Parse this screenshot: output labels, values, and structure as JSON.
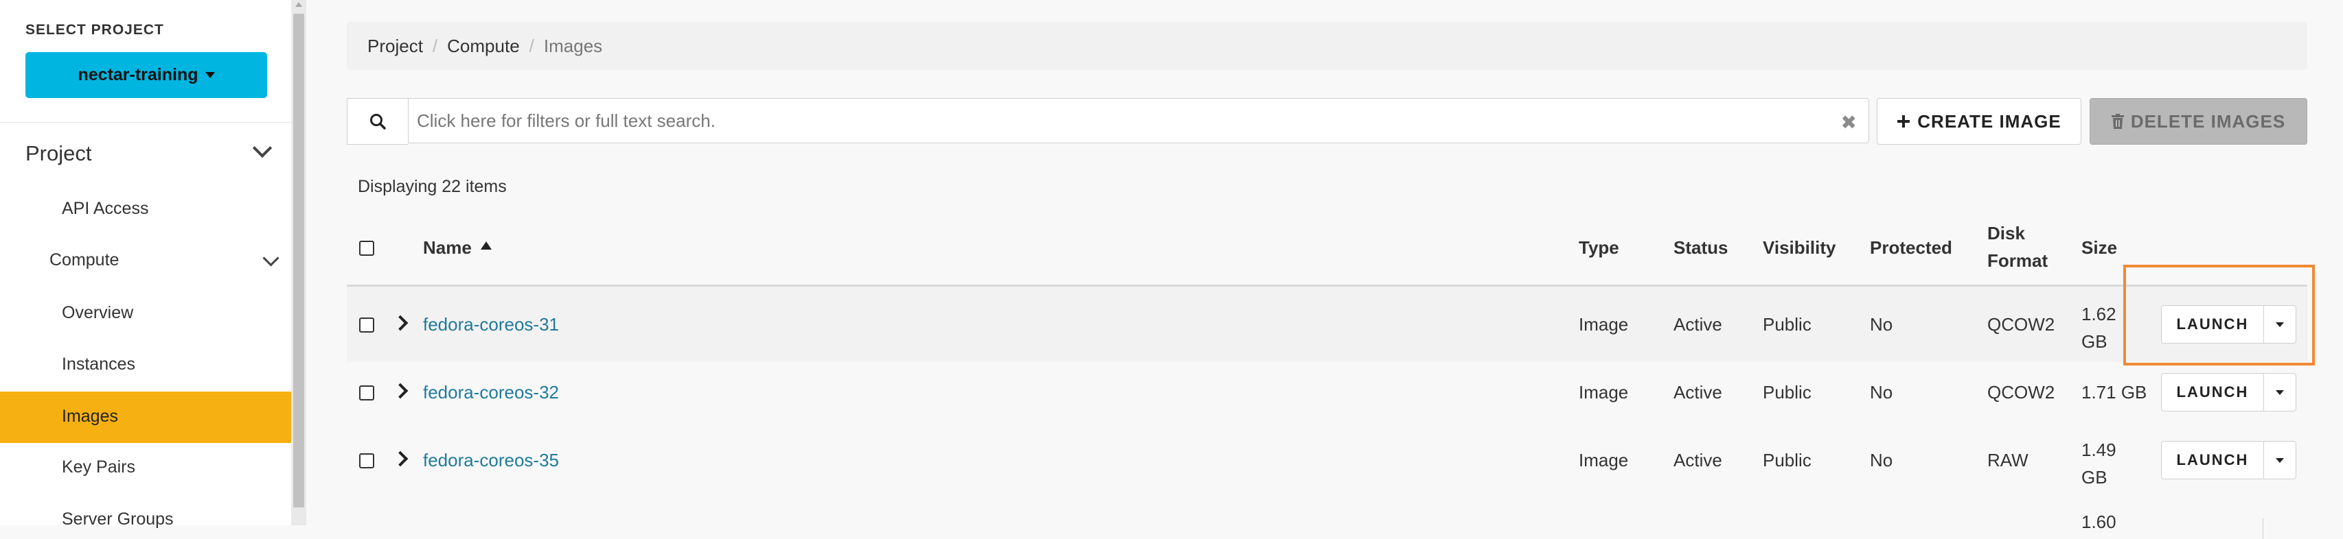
{
  "sidebar": {
    "select_label": "SELECT PROJECT",
    "project_name": "nectar-training",
    "sections": {
      "project": "Project",
      "api_access": "API Access",
      "compute": "Compute",
      "overview": "Overview",
      "instances": "Instances",
      "images": "Images",
      "key_pairs": "Key Pairs",
      "server_groups": "Server Groups"
    },
    "active_item": "Images",
    "active_color": "#f6b011"
  },
  "breadcrumb": {
    "items": [
      "Project",
      "Compute",
      "Images"
    ]
  },
  "toolbar": {
    "search_placeholder": "Click here for filters or full text search.",
    "create_label": "CREATE IMAGE",
    "delete_label": "DELETE IMAGES"
  },
  "summary": {
    "displaying": "Displaying 22 items"
  },
  "table": {
    "headers": {
      "name": "Name",
      "type": "Type",
      "status": "Status",
      "visibility": "Visibility",
      "protected": "Protected",
      "disk_format_line1": "Disk",
      "disk_format_line2": "Format",
      "size": "Size"
    },
    "sort": {
      "column": "Name",
      "direction": "ascending"
    },
    "rows": [
      {
        "name": "fedora-coreos-31",
        "type": "Image",
        "status": "Active",
        "visibility": "Public",
        "protected": "No",
        "disk_format": "QCOW2",
        "size_line1": "1.62",
        "size_line2": "GB",
        "action": "LAUNCH"
      },
      {
        "name": "fedora-coreos-32",
        "type": "Image",
        "status": "Active",
        "visibility": "Public",
        "protected": "No",
        "disk_format": "QCOW2",
        "size_line1": "1.71 GB",
        "size_line2": "",
        "action": "LAUNCH"
      },
      {
        "name": "fedora-coreos-35",
        "type": "Image",
        "status": "Active",
        "visibility": "Public",
        "protected": "No",
        "disk_format": "RAW",
        "size_line1": "1.49",
        "size_line2": "GB",
        "action": "LAUNCH"
      },
      {
        "size_line1": "1.60"
      }
    ]
  },
  "colors": {
    "accent_button": "#00b5e0",
    "link": "#1f7a9b",
    "highlight_box": "#f08a34"
  }
}
